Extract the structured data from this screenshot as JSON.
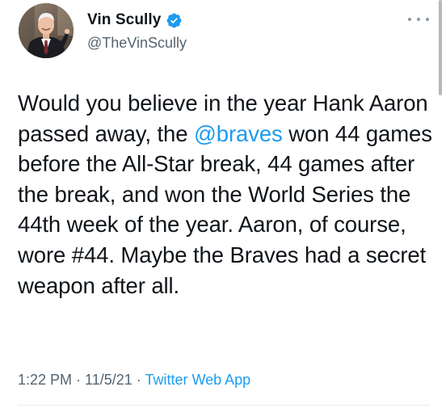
{
  "user": {
    "display_name": "Vin Scully",
    "handle": "@TheVinScully",
    "verified": true
  },
  "tweet": {
    "text_part1": "Would you believe in the year Hank Aaron passed away, the ",
    "mention": "@braves",
    "text_part2": " won 44 games before the All-Star break, 44 games after the break, and won the World Series the 44th week of the year. Aaron, of course, wore #44. Maybe the Braves had a secret weapon after all."
  },
  "meta": {
    "time": "1:22 PM",
    "separator1": " · ",
    "date": "11/5/21",
    "separator2": " · ",
    "source": "Twitter Web App"
  },
  "icons": {
    "verified": "verified-badge-icon",
    "more": "more-options-icon"
  },
  "colors": {
    "accent": "#1d9bf0",
    "text": "#0f1419",
    "secondary": "#536471"
  }
}
